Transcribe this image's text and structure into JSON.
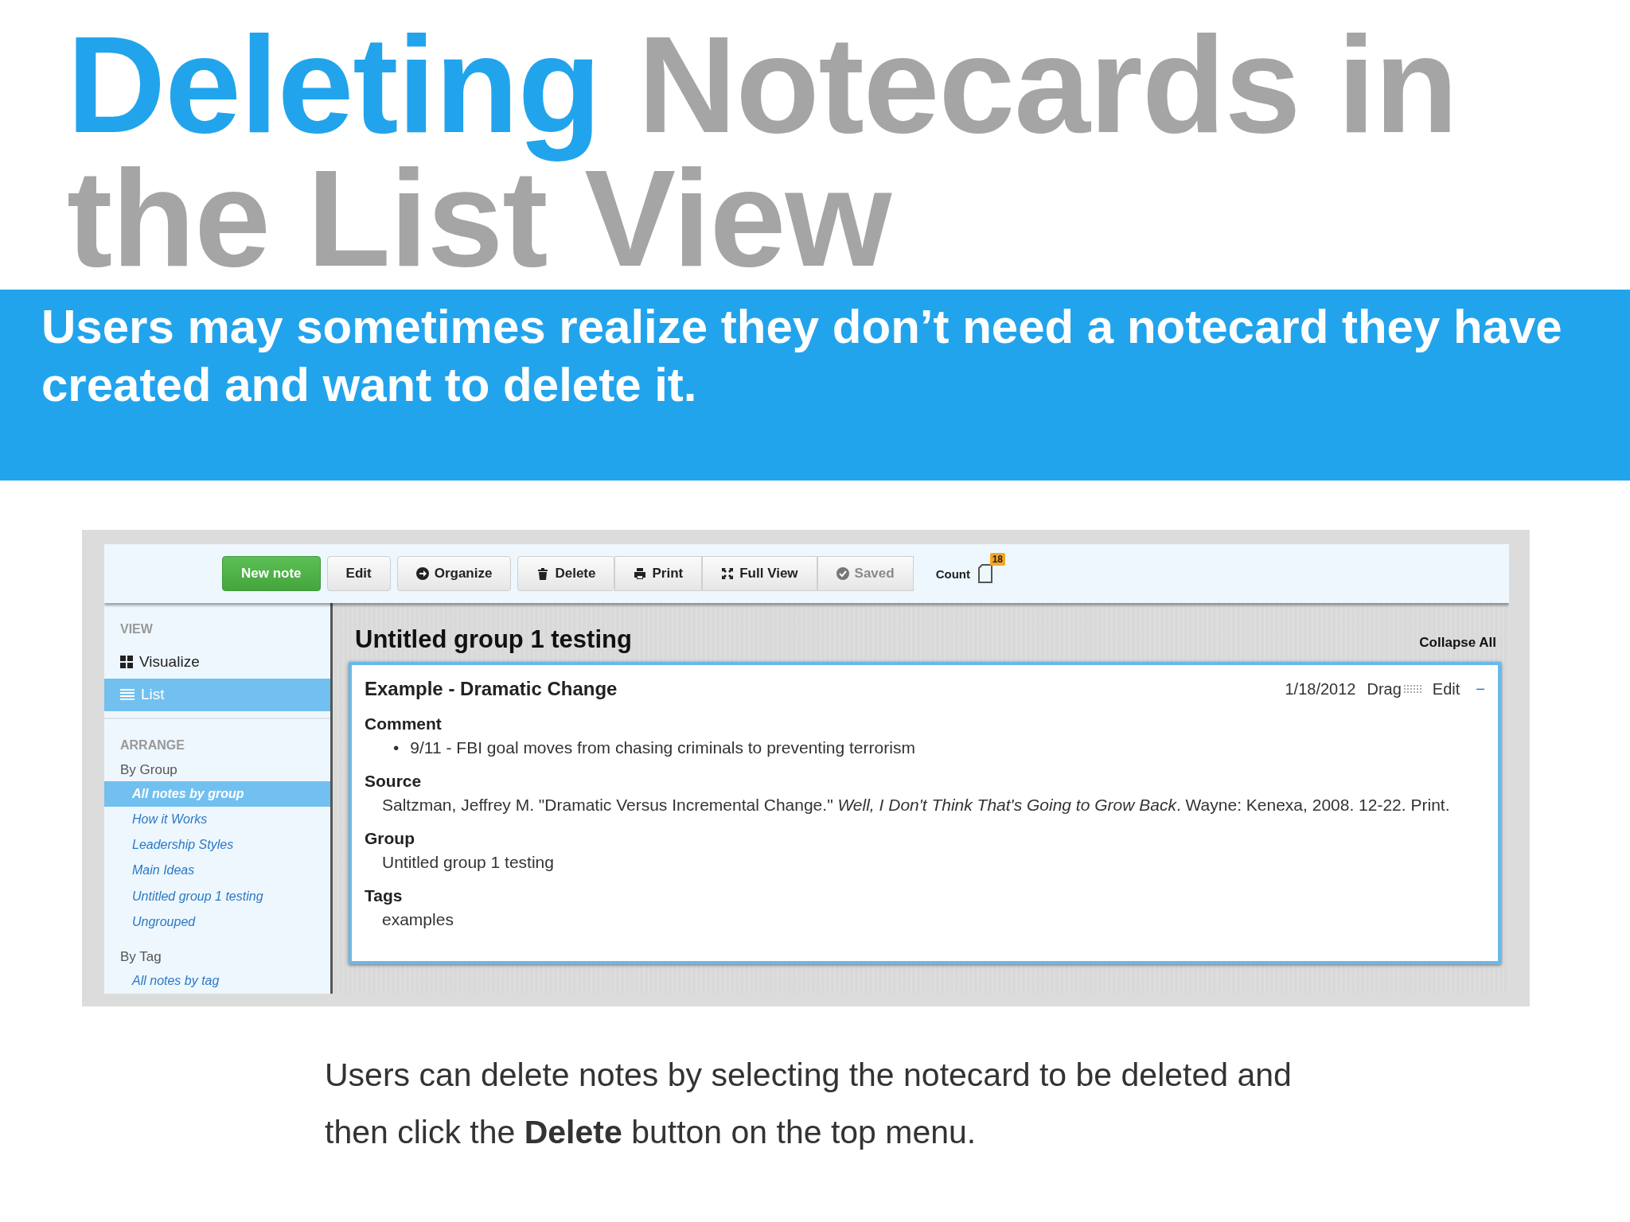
{
  "title": {
    "highlight": "Deleting",
    "rest": "Notecards in the List View"
  },
  "banner": "Users may sometimes realize they don’t need a notecard they have created and want to delete it.",
  "app": {
    "toolbar": {
      "buttons": [
        {
          "label": "New note",
          "kind": "primary",
          "disabled": false
        },
        {
          "label": "Edit",
          "kind": "plain",
          "disabled": false
        },
        {
          "label": "Organize",
          "kind": "plain",
          "disabled": false
        },
        {
          "label": "Delete",
          "kind": "plain",
          "disabled": false
        },
        {
          "label": "Print",
          "kind": "grouped",
          "disabled": false
        },
        {
          "label": "Full View",
          "kind": "grouped",
          "disabled": false
        },
        {
          "label": "Saved",
          "kind": "grouped",
          "disabled": true
        }
      ],
      "count": {
        "label": "Count",
        "badge": "18"
      }
    },
    "sidebar": {
      "view": {
        "heading": "VIEW",
        "items": [
          {
            "label": "Visualize",
            "selected": false
          },
          {
            "label": "List",
            "selected": true
          }
        ]
      },
      "arrange": {
        "heading": "ARRANGE",
        "groups": [
          {
            "label": "By Group",
            "items": [
              {
                "label": "All notes by group",
                "selected": true
              },
              {
                "label": "How it Works",
                "selected": false
              },
              {
                "label": "Leadership Styles",
                "selected": false
              },
              {
                "label": "Main Ideas",
                "selected": false
              },
              {
                "label": "Untitled group 1 testing",
                "selected": false
              },
              {
                "label": "Ungrouped",
                "selected": false
              }
            ]
          },
          {
            "label": "By Tag",
            "items": [
              {
                "label": "All notes by tag",
                "selected": false
              }
            ]
          }
        ]
      }
    },
    "main": {
      "heading": "Untitled group 1 testing",
      "collapse_all": "Collapse All",
      "card": {
        "title": "Example - Dramatic Change",
        "date": "1/18/2012",
        "drag": "Drag",
        "edit": "Edit",
        "collapse": "−",
        "fields": [
          {
            "label": "Comment",
            "kind": "bullets",
            "marker": "•",
            "values": [
              "9/11 - FBI goal moves from chasing criminals to preventing terrorism"
            ]
          },
          {
            "label": "Source",
            "kind": "text",
            "values": [
              "Saltzman, Jeffrey M. \"Dramatic Versus Incremental Change.\" *Well, I Don't Think That's Going to Grow Back*. Wayne: Kenexa, 2008. 12-22. Print."
            ]
          },
          {
            "label": "Group",
            "kind": "text",
            "values": [
              "Untitled group 1 testing"
            ]
          },
          {
            "label": "Tags",
            "kind": "text",
            "values": [
              "examples"
            ]
          }
        ]
      }
    }
  },
  "caption": [
    "Users can delete notes by selecting the notecard to be deleted and",
    "then click the **Delete** button on the top menu."
  ]
}
